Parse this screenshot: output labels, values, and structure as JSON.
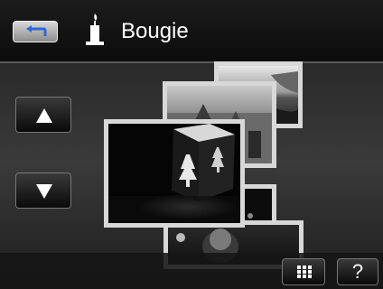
{
  "header": {
    "title": "Bougie",
    "back_icon": "back-arrow-icon",
    "scene_icon": "candle-icon"
  },
  "navigation": {
    "up_icon": "up-triangle-icon",
    "down_icon": "down-triangle-icon"
  },
  "gallery": {
    "selected_item": "candle-lantern-photo"
  },
  "footer": {
    "grid_icon": "grid-icon",
    "help_label": "?"
  },
  "colors": {
    "frame": "#d8d8d8",
    "text": "#ffffff",
    "background": "#2a2a2a"
  }
}
